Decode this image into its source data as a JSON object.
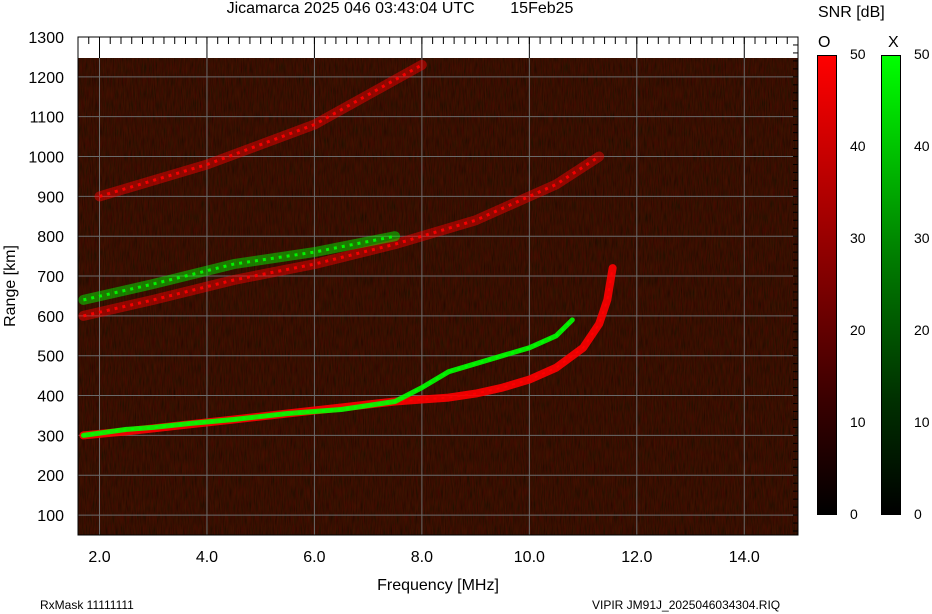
{
  "title": "Jicamarca 2025 046 03:43:04 UTC        15Feb25",
  "footer": {
    "rxmask": "RxMask 11111111",
    "filename": "VIPIR  JM91J_2025046034304.RIQ"
  },
  "colorbar": {
    "title": "SNR [dB]",
    "o_label": "O",
    "x_label": "X",
    "ticks": [
      "0",
      "10",
      "20",
      "30",
      "40",
      "50"
    ],
    "o_color": "#ff0000",
    "x_color": "#00ff00"
  },
  "chart_data": {
    "type": "heatmap",
    "title": "Jicamarca 2025 046 03:43:04 UTC        15Feb25",
    "xlabel": "Frequency [MHz]",
    "ylabel": "Range [km]",
    "xlim": [
      1.6,
      15.0
    ],
    "ylim": [
      50,
      1300
    ],
    "x_ticks": [
      "2.0",
      "4.0",
      "6.0",
      "8.0",
      "10.0",
      "12.0",
      "14.0"
    ],
    "y_ticks": [
      "100",
      "200",
      "300",
      "400",
      "500",
      "600",
      "700",
      "800",
      "900",
      "1000",
      "1100",
      "1200",
      "1300"
    ],
    "grid": true,
    "background": "#000000",
    "series": [
      {
        "name": "O",
        "color": "#ff0000",
        "traces": [
          {
            "x": [
              1.7,
              2.5,
              3.5,
              4.5,
              5.5,
              6.5,
              7.5,
              8.0,
              8.5,
              9.0,
              9.5,
              10.0,
              10.5,
              11.0,
              11.3,
              11.45,
              11.55
            ],
            "y": [
              300,
              310,
              325,
              340,
              355,
              370,
              385,
              390,
              395,
              405,
              420,
              440,
              470,
              520,
              580,
              640,
              720
            ]
          },
          {
            "x": [
              1.7,
              3.0,
              4.5,
              6.0,
              7.5,
              9.0,
              10.5,
              11.3
            ],
            "y": [
              600,
              640,
              690,
              730,
              780,
              840,
              930,
              1000
            ]
          },
          {
            "x": [
              2.0,
              4.0,
              6.0,
              8.0
            ],
            "y": [
              900,
              980,
              1080,
              1230
            ]
          }
        ]
      },
      {
        "name": "X",
        "color": "#00ff00",
        "traces": [
          {
            "x": [
              1.7,
              2.5,
              3.0,
              3.7,
              4.5,
              5.5,
              6.5,
              7.5,
              8.0,
              8.5,
              9.0,
              9.5,
              10.0,
              10.5,
              10.8
            ],
            "y": [
              300,
              315,
              320,
              330,
              340,
              355,
              365,
              385,
              420,
              460,
              480,
              500,
              520,
              550,
              590
            ]
          },
          {
            "x": [
              1.7,
              3.0,
              4.5,
              6.0,
              7.5
            ],
            "y": [
              640,
              680,
              730,
              760,
              800
            ]
          }
        ]
      }
    ]
  }
}
